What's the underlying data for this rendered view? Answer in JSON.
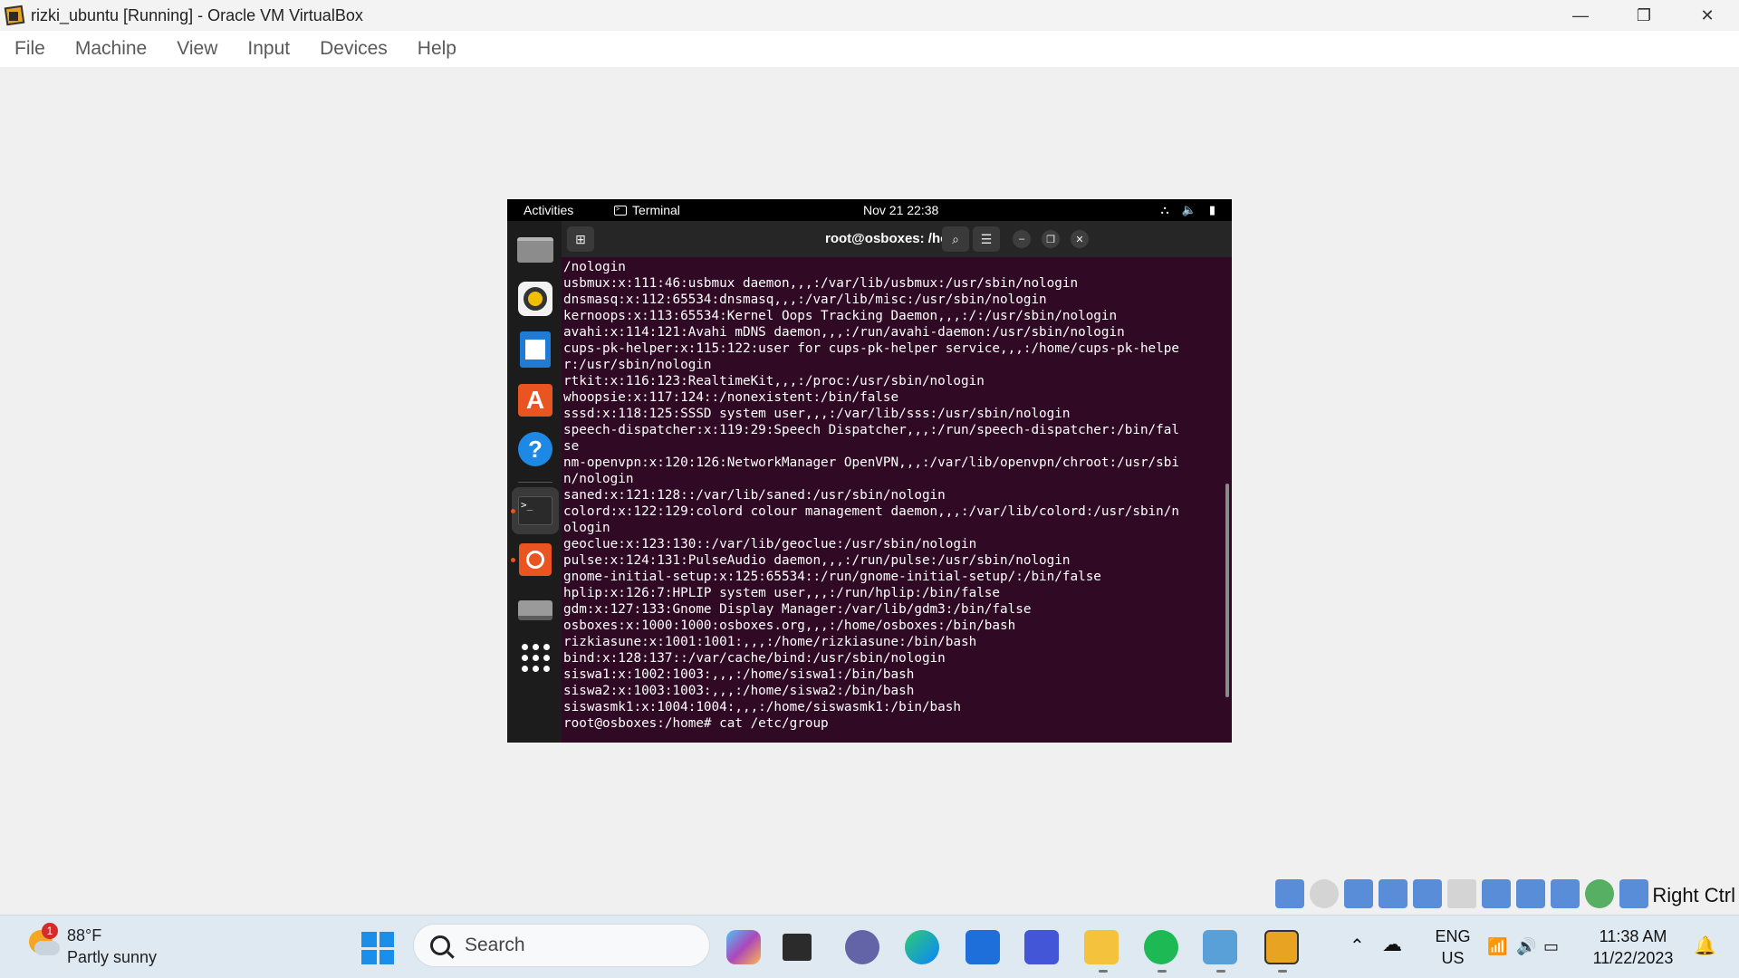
{
  "vbox": {
    "title": "rizki_ubuntu [Running] - Oracle VM VirtualBox",
    "menu": [
      "File",
      "Machine",
      "View",
      "Input",
      "Devices",
      "Help"
    ],
    "window_controls": {
      "minimize": "—",
      "restore": "❐",
      "close": "✕"
    },
    "host_key": "Right Ctrl"
  },
  "gnome": {
    "activities": "Activities",
    "app_name": "Terminal",
    "clock": "Nov 21  22:38",
    "dock_icons": [
      "files-icon",
      "rhythmbox-icon",
      "writer-icon",
      "app-center-icon",
      "help-icon",
      "terminal-icon",
      "ubuntu-icon",
      "drive-icon",
      "show-apps-icon"
    ]
  },
  "terminal": {
    "title": "root@osboxes: /home",
    "lines": [
      "/nologin",
      "usbmux:x:111:46:usbmux daemon,,,:/var/lib/usbmux:/usr/sbin/nologin",
      "dnsmasq:x:112:65534:dnsmasq,,,:/var/lib/misc:/usr/sbin/nologin",
      "kernoops:x:113:65534:Kernel Oops Tracking Daemon,,,:/:/usr/sbin/nologin",
      "avahi:x:114:121:Avahi mDNS daemon,,,:/run/avahi-daemon:/usr/sbin/nologin",
      "cups-pk-helper:x:115:122:user for cups-pk-helper service,,,:/home/cups-pk-helpe",
      "r:/usr/sbin/nologin",
      "rtkit:x:116:123:RealtimeKit,,,:/proc:/usr/sbin/nologin",
      "whoopsie:x:117:124::/nonexistent:/bin/false",
      "sssd:x:118:125:SSSD system user,,,:/var/lib/sss:/usr/sbin/nologin",
      "speech-dispatcher:x:119:29:Speech Dispatcher,,,:/run/speech-dispatcher:/bin/fal",
      "se",
      "nm-openvpn:x:120:126:NetworkManager OpenVPN,,,:/var/lib/openvpn/chroot:/usr/sbi",
      "n/nologin",
      "saned:x:121:128::/var/lib/saned:/usr/sbin/nologin",
      "colord:x:122:129:colord colour management daemon,,,:/var/lib/colord:/usr/sbin/n",
      "ologin",
      "geoclue:x:123:130::/var/lib/geoclue:/usr/sbin/nologin",
      "pulse:x:124:131:PulseAudio daemon,,,:/run/pulse:/usr/sbin/nologin",
      "gnome-initial-setup:x:125:65534::/run/gnome-initial-setup/:/bin/false",
      "hplip:x:126:7:HPLIP system user,,,:/run/hplip:/bin/false",
      "gdm:x:127:133:Gnome Display Manager:/var/lib/gdm3:/bin/false",
      "osboxes:x:1000:1000:osboxes.org,,,:/home/osboxes:/bin/bash",
      "rizkiasune:x:1001:1001:,,,:/home/rizkiasune:/bin/bash",
      "bind:x:128:137::/var/cache/bind:/usr/sbin/nologin",
      "siswa1:x:1002:1003:,,,:/home/siswa1:/bin/bash",
      "siswa2:x:1003:1003:,,,:/home/siswa2:/bin/bash",
      "siswasmk1:x:1004:1004:,,,:/home/siswasmk1:/bin/bash",
      "root@osboxes:/home# cat /etc/group"
    ]
  },
  "taskbar": {
    "weather_temp": "88°F",
    "weather_desc": "Partly sunny",
    "weather_badge": "1",
    "search_label": "Search",
    "lang_top": "ENG",
    "lang_bottom": "US",
    "time": "11:38 AM",
    "date": "11/22/2023",
    "apps": [
      "copilot-icon",
      "file-explorer-dark-icon",
      "teams-icon",
      "edge-icon",
      "store-icon",
      "app-icon",
      "file-explorer-icon",
      "spotify-icon",
      "virtualbox-icon",
      "vm-window-icon"
    ]
  }
}
